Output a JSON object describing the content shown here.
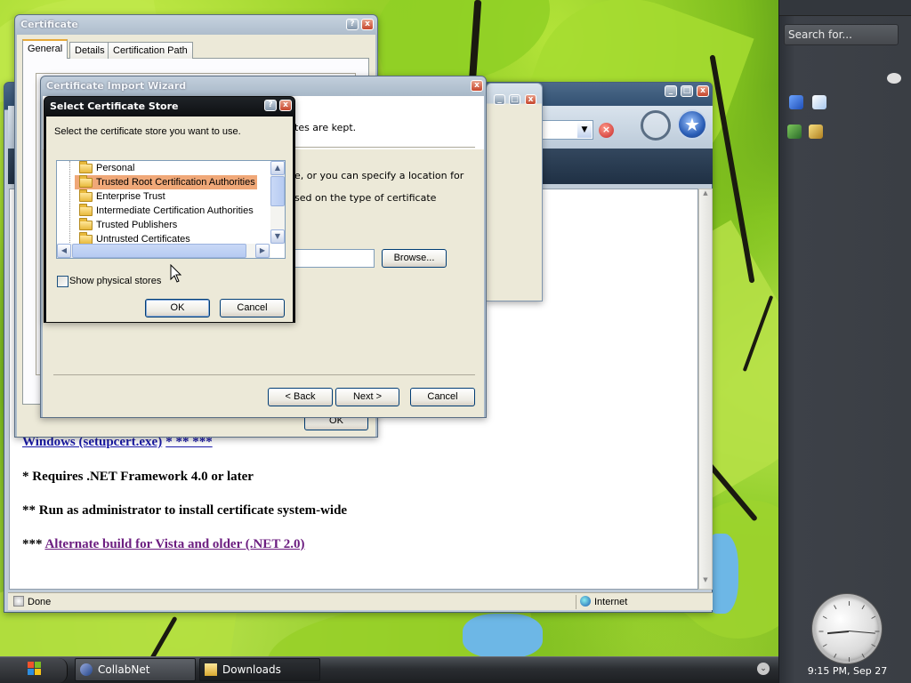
{
  "sidebar": {
    "search_placeholder": "Search for...",
    "clock_time": "9:15 PM, Sep 27"
  },
  "taskbar": {
    "items": [
      {
        "label": "CollabNet"
      },
      {
        "label": "Downloads"
      }
    ]
  },
  "ie": {
    "status_text": "Done",
    "zone_text": "Internet",
    "content": {
      "line1_link": "Windows (setupcert.exe)",
      "line1_suffix": "* ** ***",
      "line2": "* Requires .NET Framework 4.0 or later",
      "line3": "** Run as administrator to install certificate system-wide",
      "line4_prefix": "***",
      "line4_link": "Alternate build for Vista and older (.NET 2.0)"
    }
  },
  "certificate": {
    "title": "Certificate",
    "tabs": [
      "General",
      "Details",
      "Certification Path"
    ],
    "ok_label": "OK"
  },
  "wizard": {
    "title": "Certificate Import Wizard",
    "text1": "tes are kept.",
    "text2": "e, or you can specify a location for",
    "text3": "sed on the type of certificate",
    "browse_label": "Browse...",
    "back_label": "< Back",
    "next_label": "Next >",
    "cancel_label": "Cancel"
  },
  "store": {
    "title": "Select Certificate Store",
    "instruction": "Select the certificate store you want to use.",
    "items": [
      "Personal",
      "Trusted Root Certification Authorities",
      "Enterprise Trust",
      "Intermediate Certification Authorities",
      "Trusted Publishers",
      "Untrusted Certificates"
    ],
    "selected_index": 1,
    "checkbox_label": "Show physical stores",
    "checkbox_checked": false,
    "ok_label": "OK",
    "cancel_label": "Cancel"
  }
}
